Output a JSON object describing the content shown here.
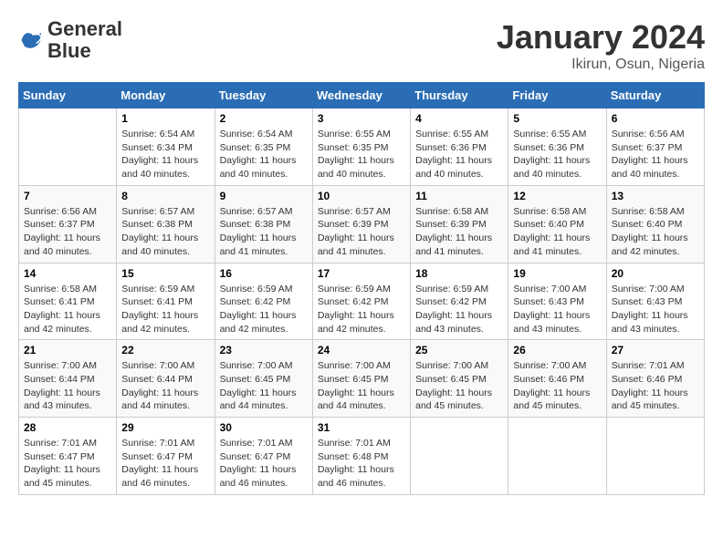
{
  "header": {
    "logo_line1": "General",
    "logo_line2": "Blue",
    "month": "January 2024",
    "location": "Ikirun, Osun, Nigeria"
  },
  "days_of_week": [
    "Sunday",
    "Monday",
    "Tuesday",
    "Wednesday",
    "Thursday",
    "Friday",
    "Saturday"
  ],
  "weeks": [
    [
      {
        "num": "",
        "sunrise": "",
        "sunset": "",
        "daylight": ""
      },
      {
        "num": "1",
        "sunrise": "Sunrise: 6:54 AM",
        "sunset": "Sunset: 6:34 PM",
        "daylight": "Daylight: 11 hours and 40 minutes."
      },
      {
        "num": "2",
        "sunrise": "Sunrise: 6:54 AM",
        "sunset": "Sunset: 6:35 PM",
        "daylight": "Daylight: 11 hours and 40 minutes."
      },
      {
        "num": "3",
        "sunrise": "Sunrise: 6:55 AM",
        "sunset": "Sunset: 6:35 PM",
        "daylight": "Daylight: 11 hours and 40 minutes."
      },
      {
        "num": "4",
        "sunrise": "Sunrise: 6:55 AM",
        "sunset": "Sunset: 6:36 PM",
        "daylight": "Daylight: 11 hours and 40 minutes."
      },
      {
        "num": "5",
        "sunrise": "Sunrise: 6:55 AM",
        "sunset": "Sunset: 6:36 PM",
        "daylight": "Daylight: 11 hours and 40 minutes."
      },
      {
        "num": "6",
        "sunrise": "Sunrise: 6:56 AM",
        "sunset": "Sunset: 6:37 PM",
        "daylight": "Daylight: 11 hours and 40 minutes."
      }
    ],
    [
      {
        "num": "7",
        "sunrise": "Sunrise: 6:56 AM",
        "sunset": "Sunset: 6:37 PM",
        "daylight": "Daylight: 11 hours and 40 minutes."
      },
      {
        "num": "8",
        "sunrise": "Sunrise: 6:57 AM",
        "sunset": "Sunset: 6:38 PM",
        "daylight": "Daylight: 11 hours and 40 minutes."
      },
      {
        "num": "9",
        "sunrise": "Sunrise: 6:57 AM",
        "sunset": "Sunset: 6:38 PM",
        "daylight": "Daylight: 11 hours and 41 minutes."
      },
      {
        "num": "10",
        "sunrise": "Sunrise: 6:57 AM",
        "sunset": "Sunset: 6:39 PM",
        "daylight": "Daylight: 11 hours and 41 minutes."
      },
      {
        "num": "11",
        "sunrise": "Sunrise: 6:58 AM",
        "sunset": "Sunset: 6:39 PM",
        "daylight": "Daylight: 11 hours and 41 minutes."
      },
      {
        "num": "12",
        "sunrise": "Sunrise: 6:58 AM",
        "sunset": "Sunset: 6:40 PM",
        "daylight": "Daylight: 11 hours and 41 minutes."
      },
      {
        "num": "13",
        "sunrise": "Sunrise: 6:58 AM",
        "sunset": "Sunset: 6:40 PM",
        "daylight": "Daylight: 11 hours and 42 minutes."
      }
    ],
    [
      {
        "num": "14",
        "sunrise": "Sunrise: 6:58 AM",
        "sunset": "Sunset: 6:41 PM",
        "daylight": "Daylight: 11 hours and 42 minutes."
      },
      {
        "num": "15",
        "sunrise": "Sunrise: 6:59 AM",
        "sunset": "Sunset: 6:41 PM",
        "daylight": "Daylight: 11 hours and 42 minutes."
      },
      {
        "num": "16",
        "sunrise": "Sunrise: 6:59 AM",
        "sunset": "Sunset: 6:42 PM",
        "daylight": "Daylight: 11 hours and 42 minutes."
      },
      {
        "num": "17",
        "sunrise": "Sunrise: 6:59 AM",
        "sunset": "Sunset: 6:42 PM",
        "daylight": "Daylight: 11 hours and 42 minutes."
      },
      {
        "num": "18",
        "sunrise": "Sunrise: 6:59 AM",
        "sunset": "Sunset: 6:42 PM",
        "daylight": "Daylight: 11 hours and 43 minutes."
      },
      {
        "num": "19",
        "sunrise": "Sunrise: 7:00 AM",
        "sunset": "Sunset: 6:43 PM",
        "daylight": "Daylight: 11 hours and 43 minutes."
      },
      {
        "num": "20",
        "sunrise": "Sunrise: 7:00 AM",
        "sunset": "Sunset: 6:43 PM",
        "daylight": "Daylight: 11 hours and 43 minutes."
      }
    ],
    [
      {
        "num": "21",
        "sunrise": "Sunrise: 7:00 AM",
        "sunset": "Sunset: 6:44 PM",
        "daylight": "Daylight: 11 hours and 43 minutes."
      },
      {
        "num": "22",
        "sunrise": "Sunrise: 7:00 AM",
        "sunset": "Sunset: 6:44 PM",
        "daylight": "Daylight: 11 hours and 44 minutes."
      },
      {
        "num": "23",
        "sunrise": "Sunrise: 7:00 AM",
        "sunset": "Sunset: 6:45 PM",
        "daylight": "Daylight: 11 hours and 44 minutes."
      },
      {
        "num": "24",
        "sunrise": "Sunrise: 7:00 AM",
        "sunset": "Sunset: 6:45 PM",
        "daylight": "Daylight: 11 hours and 44 minutes."
      },
      {
        "num": "25",
        "sunrise": "Sunrise: 7:00 AM",
        "sunset": "Sunset: 6:45 PM",
        "daylight": "Daylight: 11 hours and 45 minutes."
      },
      {
        "num": "26",
        "sunrise": "Sunrise: 7:00 AM",
        "sunset": "Sunset: 6:46 PM",
        "daylight": "Daylight: 11 hours and 45 minutes."
      },
      {
        "num": "27",
        "sunrise": "Sunrise: 7:01 AM",
        "sunset": "Sunset: 6:46 PM",
        "daylight": "Daylight: 11 hours and 45 minutes."
      }
    ],
    [
      {
        "num": "28",
        "sunrise": "Sunrise: 7:01 AM",
        "sunset": "Sunset: 6:47 PM",
        "daylight": "Daylight: 11 hours and 45 minutes."
      },
      {
        "num": "29",
        "sunrise": "Sunrise: 7:01 AM",
        "sunset": "Sunset: 6:47 PM",
        "daylight": "Daylight: 11 hours and 46 minutes."
      },
      {
        "num": "30",
        "sunrise": "Sunrise: 7:01 AM",
        "sunset": "Sunset: 6:47 PM",
        "daylight": "Daylight: 11 hours and 46 minutes."
      },
      {
        "num": "31",
        "sunrise": "Sunrise: 7:01 AM",
        "sunset": "Sunset: 6:48 PM",
        "daylight": "Daylight: 11 hours and 46 minutes."
      },
      {
        "num": "",
        "sunrise": "",
        "sunset": "",
        "daylight": ""
      },
      {
        "num": "",
        "sunrise": "",
        "sunset": "",
        "daylight": ""
      },
      {
        "num": "",
        "sunrise": "",
        "sunset": "",
        "daylight": ""
      }
    ]
  ]
}
